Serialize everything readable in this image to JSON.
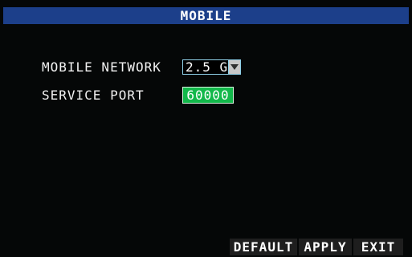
{
  "window": {
    "title": "MOBILE"
  },
  "form": {
    "mobile_network": {
      "label": "MOBILE NETWORK",
      "value": "2.5 G"
    },
    "service_port": {
      "label": "SERVICE PORT",
      "value": "60000"
    }
  },
  "buttons": {
    "default_label": "DEFAULT",
    "apply_label": "APPLY",
    "exit_label": "EXIT"
  },
  "icons": {
    "dropdown": "chevron-down-icon"
  },
  "colors": {
    "title_bar": "#1c3f8a",
    "port_field": "#12b84a",
    "select_border": "#8fd0e8",
    "background": "#050707"
  }
}
